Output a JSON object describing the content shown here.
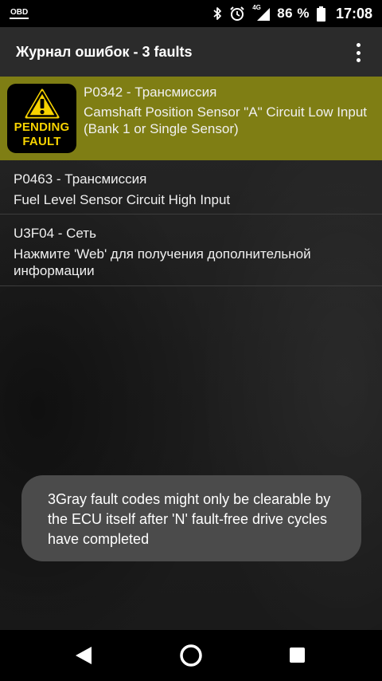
{
  "status_bar": {
    "app_icon_text": "OBD",
    "network_label": "4G",
    "battery": "86 %",
    "time": "17:08"
  },
  "app_bar": {
    "title": "Журнал ошибок - 3 faults"
  },
  "faults": [
    {
      "code": "P0342 - Трансмиссия",
      "description": "Camshaft Position Sensor \"A\" Circuit Low Input (Bank 1 or Single Sensor)",
      "badge": {
        "line1": "PENDING",
        "line2": "FAULT"
      },
      "highlight_color": "#7f7e14"
    },
    {
      "code": "P0463 - Трансмиссия",
      "description": "Fuel Level Sensor Circuit High Input"
    },
    {
      "code": "U3F04 - Сеть",
      "description": "Нажмите 'Web' для получения дополнительной информации"
    }
  ],
  "toast": {
    "message": "3Gray fault codes might only be clearable by the ECU itself after 'N' fault-free drive cycles have completed"
  },
  "icons": {
    "status": [
      "bluetooth-icon",
      "alarm-icon",
      "signal-icon",
      "battery-icon"
    ],
    "badge": "warning-triangle-icon",
    "nav": [
      "back-icon",
      "home-icon",
      "recents-icon"
    ]
  }
}
